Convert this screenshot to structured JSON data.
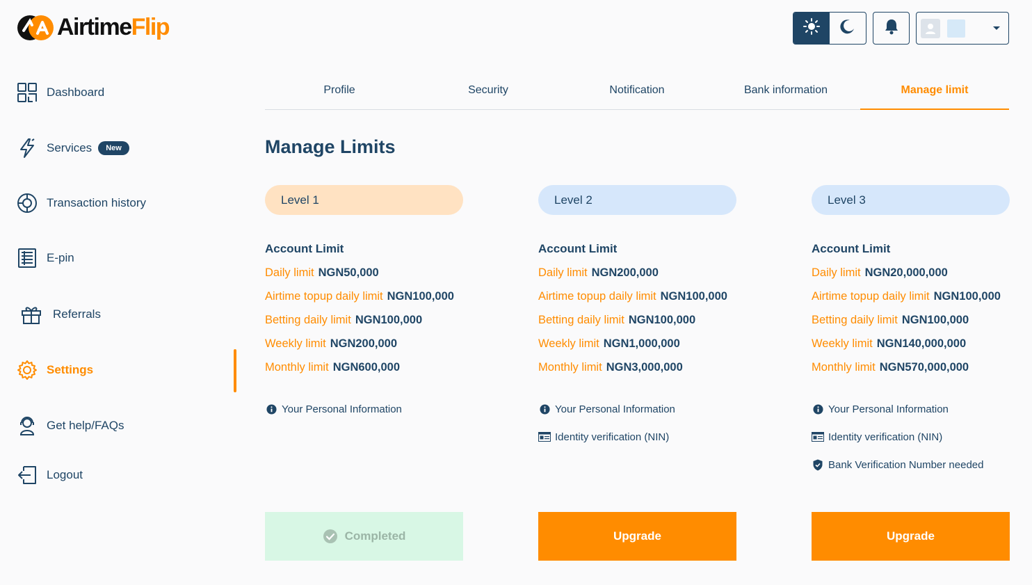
{
  "brand": {
    "name_part1": "Airtime",
    "name_part2": "Flip",
    "accent": "#ff8c00",
    "primary": "#1f4565"
  },
  "header": {
    "light_icon": "sun-icon",
    "dark_icon": "moon-icon",
    "bell_icon": "bell-icon"
  },
  "sidebar": {
    "items": [
      {
        "label": "Dashboard",
        "icon": "grid-icon"
      },
      {
        "label": "Services",
        "icon": "lightning-icon",
        "badge": "New"
      },
      {
        "label": "Transaction history",
        "icon": "history-icon"
      },
      {
        "label": "E-pin",
        "icon": "document-icon"
      },
      {
        "label": "Referrals",
        "icon": "gift-icon"
      },
      {
        "label": "Settings",
        "icon": "gear-icon",
        "active": true
      },
      {
        "label": "Get help/FAQs",
        "icon": "support-icon"
      },
      {
        "label": "Logout",
        "icon": "logout-icon"
      }
    ]
  },
  "tabs": [
    {
      "label": "Profile"
    },
    {
      "label": "Security"
    },
    {
      "label": "Notification"
    },
    {
      "label": "Bank information"
    },
    {
      "label": "Manage limit",
      "active": true
    }
  ],
  "page": {
    "title": "Manage Limits"
  },
  "levels": [
    {
      "name": "Level 1",
      "pill_color": "#ffe2c2",
      "heading": "Account Limit",
      "limits": [
        {
          "label": "Daily limit",
          "value": "NGN50,000"
        },
        {
          "label": "Airtime topup daily limit",
          "value": "NGN100,000"
        },
        {
          "label": "Betting daily limit",
          "value": "NGN100,000"
        },
        {
          "label": "Weekly limit",
          "value": "NGN200,000"
        },
        {
          "label": "Monthly limit",
          "value": "NGN600,000"
        }
      ],
      "requirements": [
        {
          "icon": "info-icon",
          "text": "Your Personal Information"
        }
      ],
      "action": {
        "label": "Completed",
        "state": "completed"
      }
    },
    {
      "name": "Level 2",
      "pill_color": "#d6e7fb",
      "heading": "Account Limit",
      "limits": [
        {
          "label": "Daily limit",
          "value": "NGN200,000"
        },
        {
          "label": "Airtime topup daily limit",
          "value": "NGN100,000"
        },
        {
          "label": "Betting daily limit",
          "value": "NGN100,000"
        },
        {
          "label": "Weekly limit",
          "value": "NGN1,000,000"
        },
        {
          "label": "Monthly limit",
          "value": "NGN3,000,000"
        }
      ],
      "requirements": [
        {
          "icon": "info-icon",
          "text": "Your Personal Information"
        },
        {
          "icon": "id-card-icon",
          "text": "Identity verification (NIN)"
        }
      ],
      "action": {
        "label": "Upgrade",
        "state": "upgrade"
      }
    },
    {
      "name": "Level 3",
      "pill_color": "#d6e7fb",
      "heading": "Account Limit",
      "limits": [
        {
          "label": "Daily limit",
          "value": "NGN20,000,000"
        },
        {
          "label": "Airtime topup daily limit",
          "value": "NGN100,000"
        },
        {
          "label": "Betting daily limit",
          "value": "NGN100,000"
        },
        {
          "label": "Weekly limit",
          "value": "NGN140,000,000"
        },
        {
          "label": "Monthly limit",
          "value": "NGN570,000,000"
        }
      ],
      "requirements": [
        {
          "icon": "info-icon",
          "text": "Your Personal Information"
        },
        {
          "icon": "id-card-icon",
          "text": "Identity verification (NIN)"
        },
        {
          "icon": "shield-check-icon",
          "text": "Bank Verification Number needed"
        }
      ],
      "action": {
        "label": "Upgrade",
        "state": "upgrade"
      }
    }
  ]
}
